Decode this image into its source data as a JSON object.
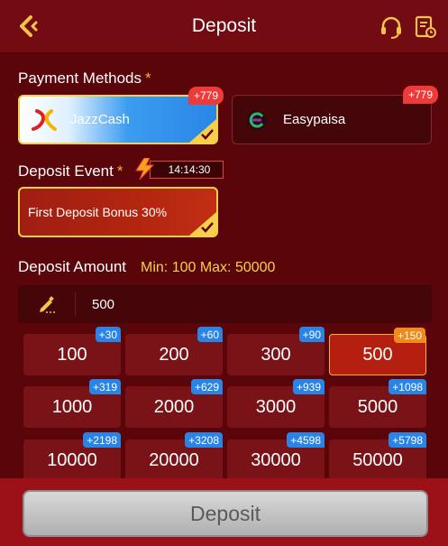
{
  "header": {
    "title": "Deposit",
    "back_icon": "chevron-left-icon",
    "support_icon": "headset-icon",
    "record_icon": "records-icon"
  },
  "payment_methods": {
    "label": "Payment Methods",
    "required_mark": "*",
    "options": [
      {
        "name": "JazzCash",
        "badge": "+779",
        "selected": true
      },
      {
        "name": "Easypaisa",
        "badge": "+779",
        "selected": false
      }
    ]
  },
  "deposit_event": {
    "label": "Deposit Event",
    "required_mark": "*",
    "timer": "14:14:30",
    "option": "First Deposit Bonus 30%"
  },
  "deposit_amount": {
    "label": "Deposit Amount",
    "minmax": "Min: 100  Max: 50000",
    "value": "500",
    "chips": [
      {
        "amount": "100",
        "bonus": "+30"
      },
      {
        "amount": "200",
        "bonus": "+60"
      },
      {
        "amount": "300",
        "bonus": "+90"
      },
      {
        "amount": "500",
        "bonus": "+150",
        "active": true
      },
      {
        "amount": "1000",
        "bonus": "+319"
      },
      {
        "amount": "2000",
        "bonus": "+629"
      },
      {
        "amount": "3000",
        "bonus": "+939"
      },
      {
        "amount": "5000",
        "bonus": "+1098"
      },
      {
        "amount": "10000",
        "bonus": "+2198"
      },
      {
        "amount": "20000",
        "bonus": "+3208"
      },
      {
        "amount": "30000",
        "bonus": "+4598"
      },
      {
        "amount": "50000",
        "bonus": "+5798"
      }
    ]
  },
  "footer": {
    "button_label": "Deposit"
  },
  "colors": {
    "background": "#5a0509",
    "header": "#720c12",
    "accent_gold": "#f6d04a",
    "badge_red": "#ef3a3a",
    "bonus_blue": "#2a84e6",
    "bonus_orange": "#f08a1a"
  }
}
